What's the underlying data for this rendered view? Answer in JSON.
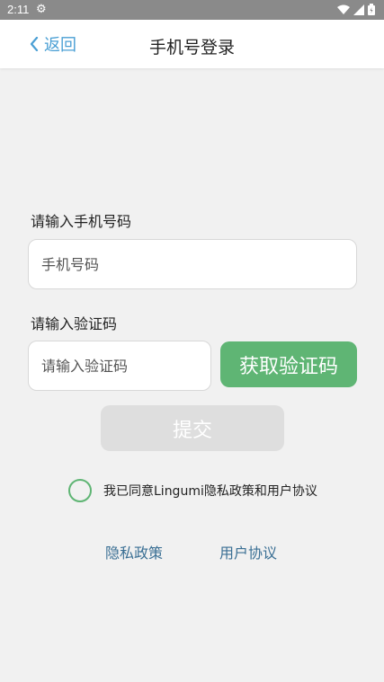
{
  "status_bar": {
    "time": "2:11",
    "icons": [
      "gear-icon",
      "wifi-icon",
      "signal-icon",
      "battery-icon"
    ]
  },
  "header": {
    "back_label": "返回",
    "title": "手机号登录"
  },
  "form": {
    "phone_label": "请输入手机号码",
    "phone_placeholder": "手机号码",
    "phone_value": "",
    "code_label": "请输入验证码",
    "code_placeholder": "请输入验证码",
    "code_value": "",
    "get_code_label": "获取验证码",
    "submit_label": "提交"
  },
  "agreement": {
    "text": "我已同意Lingumi隐私政策和用户协议",
    "checked": false
  },
  "links": {
    "privacy": "隐私政策",
    "terms": "用户协议"
  },
  "colors": {
    "accent_green": "#5fb574",
    "back_blue": "#4a9fd4",
    "link_blue": "#3a6f94",
    "disabled_gray": "#dedede",
    "status_bar_gray": "#8a8a8a"
  }
}
